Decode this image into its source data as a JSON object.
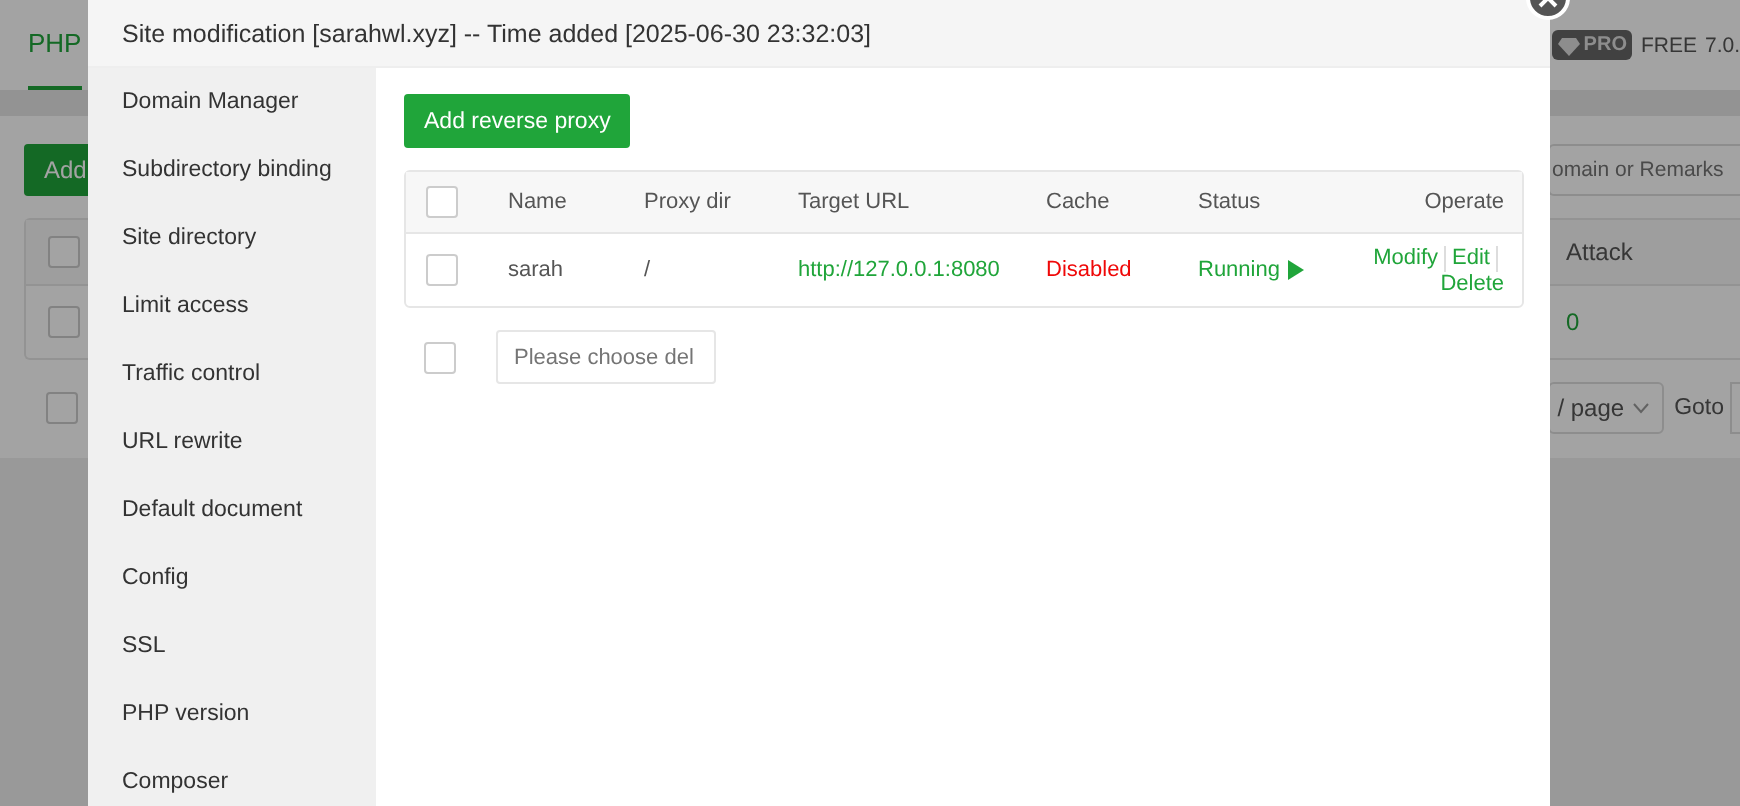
{
  "background": {
    "tab": "PHP",
    "badge": "PRO",
    "edition": "FREE",
    "version": "7.0.",
    "add_button": "Add",
    "search": {
      "placeholder": "omain or Remarks"
    },
    "table": {
      "header_checked": false,
      "columns": [
        "Attack"
      ],
      "rows": [
        {
          "checked": false,
          "cells": [
            "0"
          ]
        }
      ]
    },
    "pagination": {
      "checked": false,
      "page_size": "/ page",
      "goto": "Goto"
    }
  },
  "modal": {
    "title": "Site modification [sarahwl.xyz] -- Time added [2025-06-30 23:32:03]",
    "sidebar": {
      "items": [
        "Domain Manager",
        "Subdirectory binding",
        "Site directory",
        "Limit access",
        "Traffic control",
        "URL rewrite",
        "Default document",
        "Config",
        "SSL",
        "PHP version",
        "Composer"
      ]
    },
    "add_button": "Add reverse proxy",
    "table": {
      "header_checked": false,
      "columns": [
        "Name",
        "Proxy dir",
        "Target URL",
        "Cache",
        "Status",
        "Operate"
      ],
      "rows": [
        {
          "checked": false,
          "name": "sarah",
          "proxy_dir": "/",
          "target_url": "http://127.0.0.1:8080",
          "cache": "Disabled",
          "cache_enabled": false,
          "status": "Running",
          "running": true,
          "actions": [
            "Modify",
            "Edit",
            "Delete"
          ]
        }
      ]
    },
    "batch": {
      "checked": false,
      "placeholder": "Please choose del"
    }
  }
}
